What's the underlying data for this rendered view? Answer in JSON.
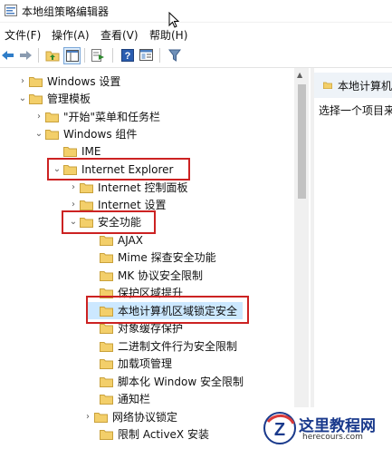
{
  "window": {
    "title": "本地组策略编辑器"
  },
  "menu": [
    "文件(F)",
    "操作(A)",
    "查看(V)",
    "帮助(H)"
  ],
  "toolbar": {
    "icons": [
      "back-arrow-icon",
      "forward-arrow-icon",
      "up-folder-icon",
      "show-hide-tree-icon",
      "export-list-icon",
      "help-icon",
      "properties-icon",
      "filter-icon"
    ]
  },
  "tree": {
    "nodes": [
      {
        "label": "Windows 设置",
        "expand": "collapsed"
      },
      {
        "label": "管理模板",
        "expand": "expanded"
      },
      {
        "label": "\"开始\"菜单和任务栏",
        "expand": "collapsed"
      },
      {
        "label": "Windows 组件",
        "expand": "expanded"
      },
      {
        "label": "IME",
        "expand": "none"
      },
      {
        "label": "Internet Explorer",
        "expand": "expanded"
      },
      {
        "label": "Internet 控制面板",
        "expand": "collapsed"
      },
      {
        "label": "Internet 设置",
        "expand": "collapsed"
      },
      {
        "label": "安全功能",
        "expand": "expanded"
      },
      {
        "label": "AJAX",
        "expand": "none"
      },
      {
        "label": "Mime 探查安全功能",
        "expand": "none"
      },
      {
        "label": "MK 协议安全限制",
        "expand": "none"
      },
      {
        "label": "保护区域提升",
        "expand": "none"
      },
      {
        "label": "本地计算机区域锁定安全",
        "expand": "none",
        "selected": true
      },
      {
        "label": "对象缓存保护",
        "expand": "none"
      },
      {
        "label": "二进制文件行为安全限制",
        "expand": "none"
      },
      {
        "label": "加载项管理",
        "expand": "none"
      },
      {
        "label": "脚本化 Window 安全限制",
        "expand": "none"
      },
      {
        "label": "通知栏",
        "expand": "none"
      },
      {
        "label": "网络协议锁定",
        "expand": "collapsed"
      },
      {
        "label": "限制 ActiveX 安装",
        "expand": "none"
      }
    ]
  },
  "right_pane": {
    "header": "本地计算机",
    "description": "选择一个项目来"
  },
  "watermark": {
    "name": "这里教程网",
    "site": "herecours.com"
  },
  "colors": {
    "highlight": "#cc2222",
    "selection": "#cce8ff",
    "folder": "#f3cf6a"
  }
}
